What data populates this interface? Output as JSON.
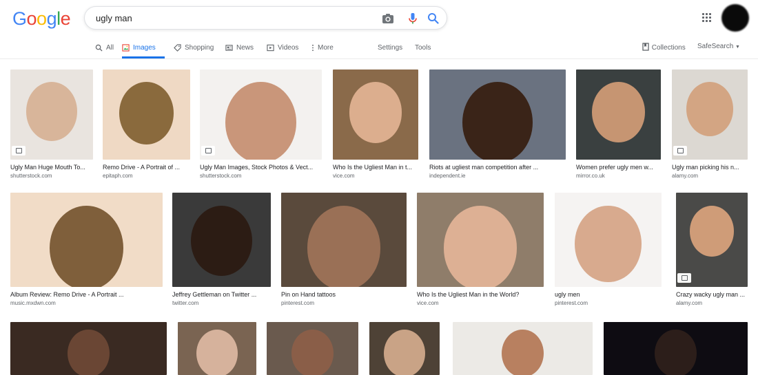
{
  "logo": {
    "letters": [
      "G",
      "o",
      "o",
      "g",
      "l",
      "e"
    ],
    "colors": [
      "#4285f4",
      "#ea4335",
      "#fbbc05",
      "#4285f4",
      "#34a853",
      "#ea4335"
    ]
  },
  "search": {
    "query": "ugly man"
  },
  "tabs": [
    {
      "label": "All",
      "icon": "search-icon"
    },
    {
      "label": "Images",
      "icon": "image-icon",
      "active": true
    },
    {
      "label": "Shopping",
      "icon": "tag-icon"
    },
    {
      "label": "News",
      "icon": "news-icon"
    },
    {
      "label": "Videos",
      "icon": "video-icon"
    },
    {
      "label": "More",
      "icon": "more-icon"
    }
  ],
  "tools": {
    "settings": "Settings",
    "tools": "Tools"
  },
  "right": {
    "collections": "Collections",
    "safesearch": "SafeSearch"
  },
  "results": [
    {
      "caption": "Ugly Man Huge Mouth To...",
      "domain": "shutterstock.com",
      "colors": [
        "#e9e4df",
        "#d8b59a"
      ]
    },
    {
      "caption": "Remo Drive - A Portrait of ...",
      "domain": "epitaph.com",
      "colors": [
        "#efd9c4",
        "#8a6a3d"
      ]
    },
    {
      "caption": "Ugly Man Images, Stock Photos & Vect...",
      "domain": "shutterstock.com",
      "colors": [
        "#f3f1ef",
        "#c9967a"
      ]
    },
    {
      "caption": "Who Is the Ugliest Man in t...",
      "domain": "vice.com",
      "colors": [
        "#8a6a4a",
        "#dcae8e"
      ]
    },
    {
      "caption": "Riots at ugliest man competition after ...",
      "domain": "independent.ie",
      "colors": [
        "#6a7280",
        "#3a2418"
      ]
    },
    {
      "caption": "Women prefer ugly men w...",
      "domain": "mirror.co.uk",
      "colors": [
        "#3a4040",
        "#c69572"
      ]
    },
    {
      "caption": "Ugly man picking his n...",
      "domain": "alamy.com",
      "colors": [
        "#dcd8d2",
        "#d3a583"
      ]
    },
    {
      "caption": "Album Review: Remo Drive - A Portrait ...",
      "domain": "music.mxdwn.com",
      "colors": [
        "#f1dcc7",
        "#7f5f3b"
      ]
    },
    {
      "caption": "Jeffrey Gettleman on Twitter ...",
      "domain": "twitter.com",
      "colors": [
        "#3a3a3a",
        "#2c1c14"
      ]
    },
    {
      "caption": "Pin on Hand tattoos",
      "domain": "pinterest.com",
      "colors": [
        "#5a4a3c",
        "#9a7056"
      ]
    },
    {
      "caption": "Who Is the Ugliest Man in the World?",
      "domain": "vice.com",
      "colors": [
        "#8f7d6a",
        "#ddb094"
      ]
    },
    {
      "caption": "ugly men",
      "domain": "pinterest.com",
      "colors": [
        "#f5f3f2",
        "#d8aa8e"
      ]
    },
    {
      "caption": "Crazy wacky ugly man ...",
      "domain": "alamy.com",
      "colors": [
        "#4a4a48",
        "#cf9c78"
      ]
    },
    {
      "caption": "",
      "domain": "",
      "colors": [
        "#3a2a22",
        "#6a4634"
      ]
    },
    {
      "caption": "",
      "domain": "",
      "colors": [
        "#7a6452",
        "#d6b29c"
      ]
    },
    {
      "caption": "",
      "domain": "",
      "colors": [
        "#6a5a4e",
        "#8a5e48"
      ]
    },
    {
      "caption": "",
      "domain": "",
      "colors": [
        "#4e4236",
        "#c9a386"
      ]
    },
    {
      "caption": "",
      "domain": "",
      "colors": [
        "#eceae6",
        "#b88060"
      ]
    },
    {
      "caption": "",
      "domain": "",
      "colors": [
        "#0e0c12",
        "#2c1e1a"
      ]
    }
  ]
}
